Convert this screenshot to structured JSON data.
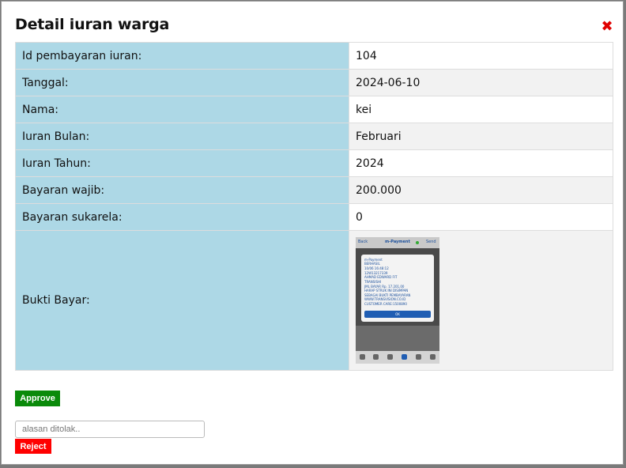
{
  "modal": {
    "title": "Detail iuran warga",
    "close_icon": "close-icon"
  },
  "details": [
    {
      "label": "Id pembayaran iuran:",
      "value": "104"
    },
    {
      "label": "Tanggal:",
      "value": "2024-06-10"
    },
    {
      "label": "Nama:",
      "value": "kei"
    },
    {
      "label": "Iuran Bulan:",
      "value": "Februari"
    },
    {
      "label": "Iuran Tahun:",
      "value": "2024"
    },
    {
      "label": "Bayaran wajib:",
      "value": "200.000"
    },
    {
      "label": "Bayaran sukarela:",
      "value": "0"
    }
  ],
  "proof": {
    "label": "Bukti Bayar:",
    "image": {
      "back": "Back",
      "header": "m-Payment",
      "send": "Send",
      "lines": [
        "m-Payment",
        "BERHASIL",
        "10/06 16:48:12",
        "12W13217339",
        "AHMAD EDWARD FIT",
        "TRANSISHI",
        "JML BAYAR Rp. 17.201,00",
        "HARAP STRUK INI DISIMPAN",
        "SEBAGAI BUKTI PEMBAYARAN",
        "WWW.TRANSVISION.CO.ID",
        "CUSTOMER CARE:1500890"
      ],
      "ok": "OK"
    }
  },
  "actions": {
    "approve_label": "Approve",
    "reason_placeholder": "alasan ditolak..",
    "reject_label": "Reject"
  },
  "colors": {
    "label_bg": "#add8e6",
    "approve": "#0a8a0a",
    "reject": "#ff0000",
    "close": "#e00000"
  }
}
